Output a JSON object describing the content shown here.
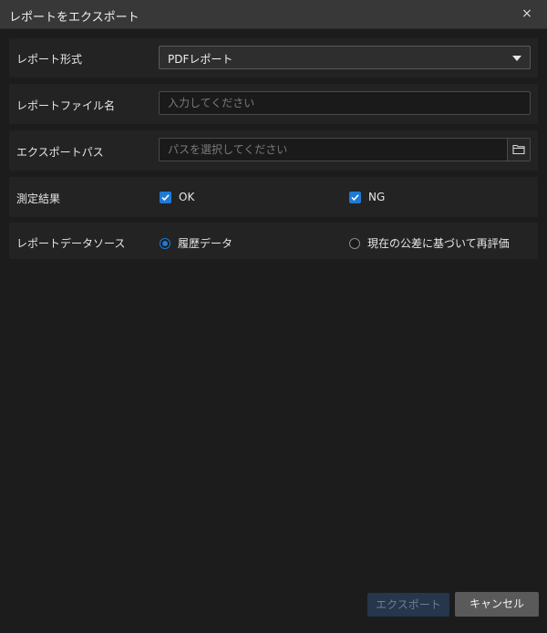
{
  "dialog": {
    "title": "レポートをエクスポート",
    "close_glyph": "×"
  },
  "report_format": {
    "label": "レポート形式",
    "selected": "PDFレポート"
  },
  "file_name": {
    "label": "レポートファイル名",
    "value": "",
    "placeholder": "入力してください"
  },
  "export_path": {
    "label": "エクスポートパス",
    "value": "",
    "placeholder": "パスを選択してください",
    "browse_icon": "folder-icon"
  },
  "measurement_result": {
    "label": "測定結果",
    "options": [
      {
        "label": "OK",
        "checked": true
      },
      {
        "label": "NG",
        "checked": true
      }
    ]
  },
  "data_source": {
    "label": "レポートデータソース",
    "options": [
      {
        "label": "履歴データ",
        "selected": true
      },
      {
        "label": "現在の公差に基づいて再評価",
        "selected": false
      }
    ]
  },
  "footer": {
    "export_label": "エクスポート",
    "cancel_label": "キャンセル"
  },
  "colors": {
    "accent": "#1e7ad6",
    "background": "#1c1c1c",
    "titlebar": "#383838",
    "export_disabled_bg": "#25364d",
    "cancel_bg": "#5a5a5a"
  }
}
